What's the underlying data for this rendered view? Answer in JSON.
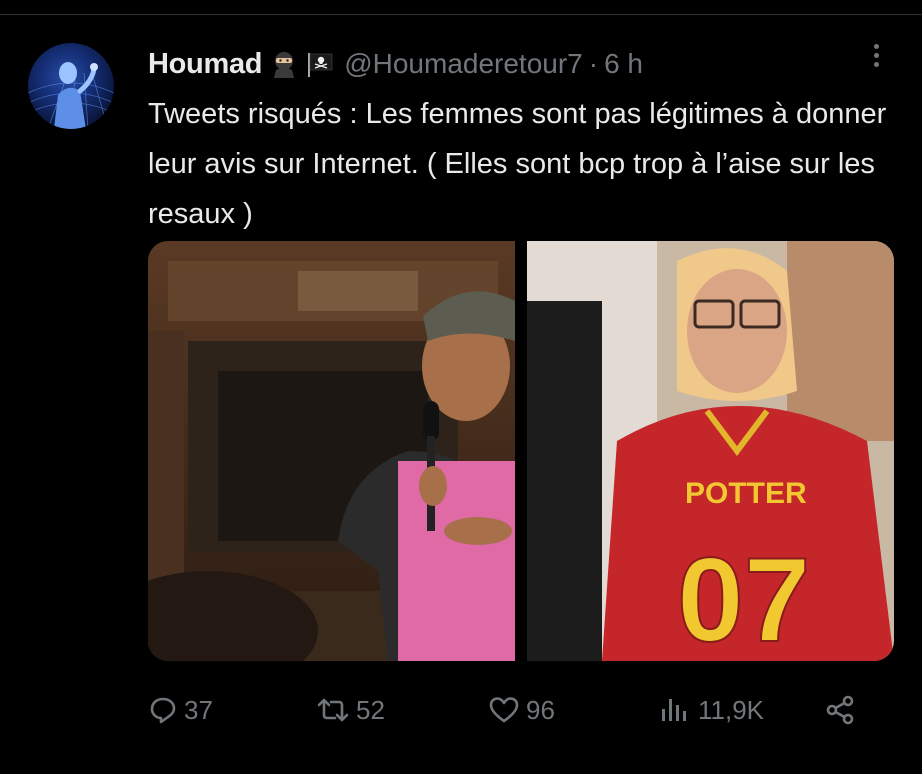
{
  "tweet": {
    "display_name": "Houmad",
    "handle": "@Houmaderetour7",
    "separator": "·",
    "time": "6 h",
    "text": "Tweets risqués : Les femmes sont pas légitimes à donner leur avis sur Internet. ( Elles sont bcp trop à l’aise sur les resaux )",
    "badges": [
      "ninja-emoji",
      "pirate-flag-emoji"
    ]
  },
  "media": {
    "photos": [
      {
        "name": "woman-speaking-into-microphone",
        "visible_text": ""
      },
      {
        "name": "woman-in-red-jersey",
        "visible_text": "POTTER 07"
      }
    ],
    "jersey_text": "POTTER",
    "jersey_number": "07"
  },
  "actions": {
    "replies": "37",
    "retweets": "52",
    "likes": "96",
    "views": "11,9K"
  },
  "colors": {
    "background": "#000000",
    "text_primary": "#e7e9ea",
    "text_secondary": "#71767b",
    "divider": "#2f3336"
  }
}
